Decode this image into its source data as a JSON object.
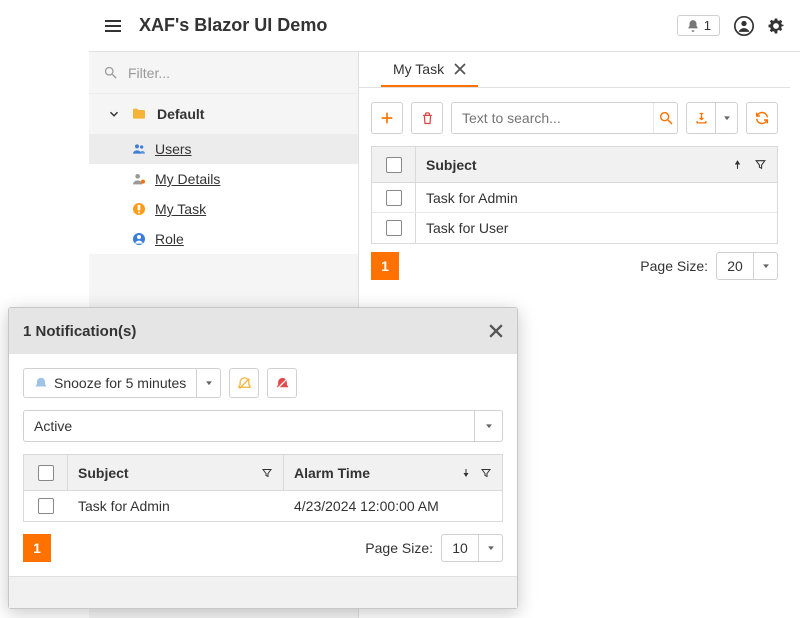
{
  "app_title": "XAF's Blazor UI Demo",
  "notif_count": "1",
  "nav": {
    "filter_placeholder": "Filter...",
    "group": "Default",
    "items": [
      {
        "label": "Users",
        "icon": "users-icon"
      },
      {
        "label": "My Details",
        "icon": "person-icon"
      },
      {
        "label": "My Task",
        "icon": "task-icon"
      },
      {
        "label": "Role",
        "icon": "role-icon"
      }
    ]
  },
  "tab": {
    "label": "My Task"
  },
  "toolbar": {
    "search_placeholder": "Text to search..."
  },
  "grid": {
    "header_subject": "Subject",
    "rows": [
      {
        "subject": "Task for Admin"
      },
      {
        "subject": "Task for User"
      }
    ],
    "page": "1",
    "page_size_label": "Page Size:",
    "page_size": "20"
  },
  "dialog": {
    "title": "1 Notification(s)",
    "snooze_label": "Snooze for 5 minutes",
    "filter_sel": "Active",
    "header_subject": "Subject",
    "header_alarm": "Alarm Time",
    "rows": [
      {
        "subject": "Task for Admin",
        "alarm": "4/23/2024 12:00:00 AM"
      }
    ],
    "page": "1",
    "page_size_label": "Page Size:",
    "page_size": "10"
  }
}
